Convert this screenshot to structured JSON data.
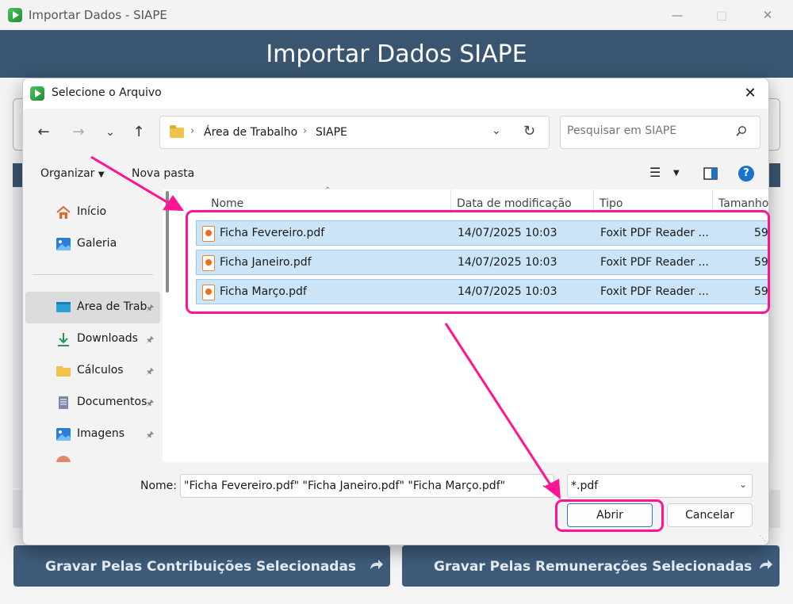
{
  "main_window": {
    "title": "Importar Dados - SIAPE",
    "header": "Importar Dados SIAPE",
    "buttons": {
      "gravar_contribuicoes": "Gravar Pelas Contribuições Selecionadas",
      "gravar_remuneracoes": "Gravar Pelas Remunerações Selecionadas"
    }
  },
  "dialog": {
    "title": "Selecione o Arquivo",
    "breadcrumb": [
      "Área de Trabalho",
      "SIAPE"
    ],
    "search_placeholder": "Pesquisar em SIAPE",
    "commands": {
      "organize": "Organizar",
      "new_folder": "Nova pasta"
    },
    "sidebar": [
      {
        "label": "Início",
        "icon": "home-icon",
        "pinned": false
      },
      {
        "label": "Galeria",
        "icon": "gallery-icon",
        "pinned": false
      },
      {
        "label": "Área de Trab",
        "icon": "desktop-icon",
        "pinned": true,
        "active": true
      },
      {
        "label": "Downloads",
        "icon": "download-icon",
        "pinned": true
      },
      {
        "label": "Cálculos",
        "icon": "folder-icon",
        "pinned": true
      },
      {
        "label": "Documentos",
        "icon": "document-icon",
        "pinned": true
      },
      {
        "label": "Imagens",
        "icon": "image-icon",
        "pinned": true
      }
    ],
    "columns": [
      "Nome",
      "Data de modificação",
      "Tipo",
      "Tamanho"
    ],
    "files": [
      {
        "name": "Ficha Fevereiro.pdf",
        "modified": "14/07/2025 10:03",
        "type": "Foxit PDF Reader ...",
        "size": "59"
      },
      {
        "name": "Ficha Janeiro.pdf",
        "modified": "14/07/2025 10:03",
        "type": "Foxit PDF Reader ...",
        "size": "59"
      },
      {
        "name": "Ficha Março.pdf",
        "modified": "14/07/2025 10:03",
        "type": "Foxit PDF Reader ...",
        "size": "59"
      }
    ],
    "name_label": "Nome:",
    "name_value": "\"Ficha Fevereiro.pdf\" \"Ficha Janeiro.pdf\" \"Ficha Março.pdf\"",
    "file_type": "*.pdf",
    "open_button": "Abrir",
    "cancel_button": "Cancelar",
    "help": "?"
  },
  "colors": {
    "header_bg": "#3a5570",
    "highlight": "#ff1493",
    "selection_bg": "#cce4f7",
    "selection_border": "#99c9ef",
    "accent": "#1a73c8"
  }
}
